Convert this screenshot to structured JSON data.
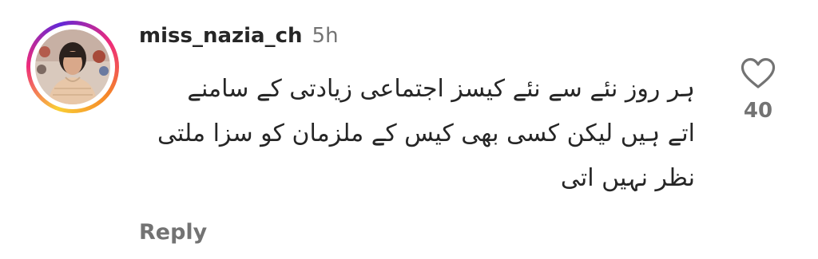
{
  "comment": {
    "username": "miss_nazia_ch",
    "time": "5h",
    "text_lines": [
      "ہر روز نئے سے نئے کیسز اجتماعی زیادتی کے سامنے",
      "اتے ہیں لیکن کسی بھی کیس کے ملزمان کو سزا ملتی",
      "نظر نہیں اتی"
    ],
    "reply_label": "Reply",
    "like_count": "40",
    "avatar_icon": "profile-photo",
    "like_icon": "heart-outline-icon"
  }
}
